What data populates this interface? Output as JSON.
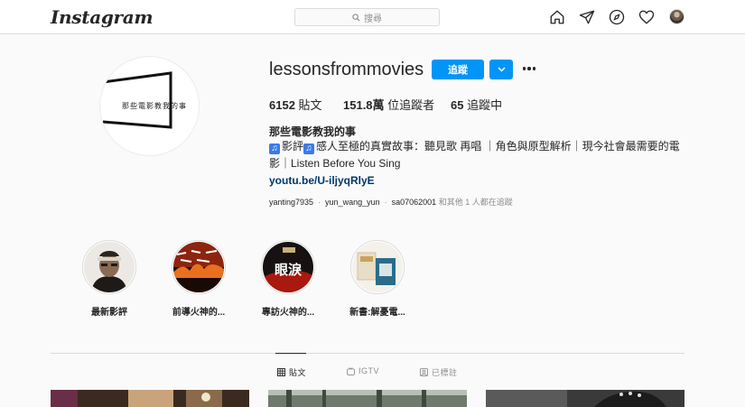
{
  "header": {
    "logo": "Instagram",
    "search_placeholder": "搜尋",
    "nav_icons": [
      "home-icon",
      "direct-icon",
      "explore-icon",
      "activity-heart-icon",
      "profile-avatar"
    ]
  },
  "profile": {
    "pic_text": "那些電影教我的事",
    "username": "lessonsfrommovies",
    "follow_label": "追蹤",
    "stats": [
      {
        "value": "6152",
        "label": "貼文"
      },
      {
        "value": "151.8萬",
        "label": "位追蹤者"
      },
      {
        "value": "65",
        "label": "追蹤中"
      }
    ],
    "full_name": "那些電影教我的事",
    "bio_line1_a": "影評",
    "bio_line1_b": "感人至極的真實故事：聽見歌 再唱 ｜角色與原型解析｜現今社會最需要的電",
    "bio_line2": "影｜Listen Before You Sing",
    "link": "youtu.be/U-iljyqRlyE",
    "followed_by": {
      "users": [
        "yanting7935",
        "yun_wang_yun",
        "sa07062001"
      ],
      "suffix": "和其他 1 人都在追蹤"
    }
  },
  "highlights": [
    {
      "label": "最新影評",
      "icon": "portrait-man"
    },
    {
      "label": "前導火神的...",
      "icon": "fire-poster"
    },
    {
      "label": "專訪火神的...",
      "icon": "podcast-tears"
    },
    {
      "label": "新書:解憂電...",
      "icon": "book-covers"
    }
  ],
  "tabs": [
    {
      "label": "貼文",
      "icon": "grid-icon",
      "active": true
    },
    {
      "label": "IGTV",
      "icon": "igtv-icon",
      "active": false
    },
    {
      "label": "已標註",
      "icon": "tagged-icon",
      "active": false
    }
  ],
  "colors": {
    "accent": "#0095f6",
    "link": "#00376b",
    "border": "#dbdbdb",
    "background": "#fafafa"
  }
}
